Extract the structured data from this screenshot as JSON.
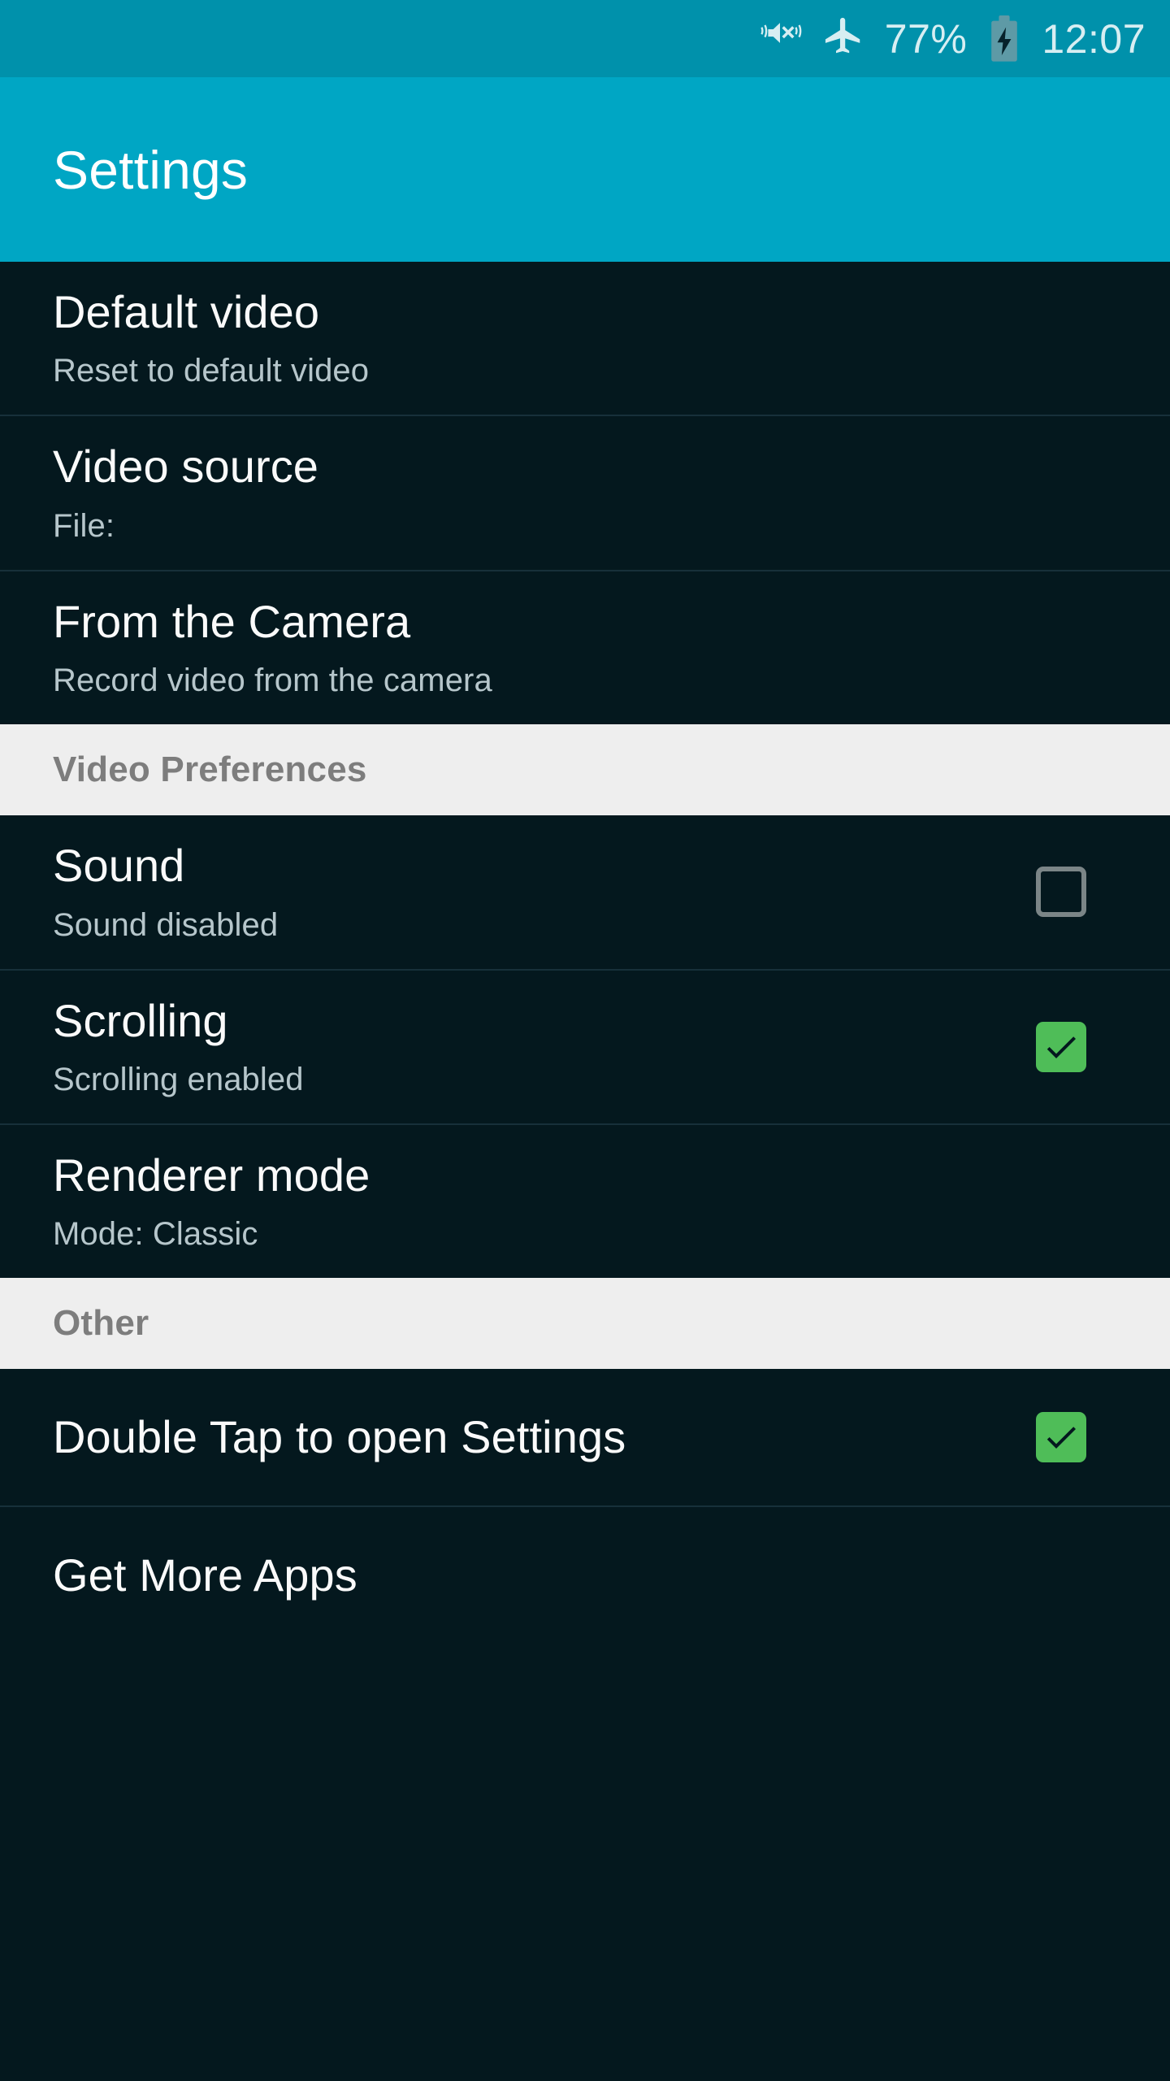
{
  "status_bar": {
    "icons": [
      "vibrate-mute-icon",
      "airplane-mode-icon",
      "battery-charging-icon"
    ],
    "battery_percent": "77%",
    "time": "12:07"
  },
  "app_bar": {
    "title": "Settings"
  },
  "colors": {
    "status_bar_bg": "#0091ab",
    "app_bar_bg": "#00a6c4",
    "list_bg": "#04181e",
    "section_header_bg": "#eeeeee",
    "section_header_text": "#7d7d7d",
    "title_text": "#fafafa",
    "summary_text": "#b6c6cb",
    "checkbox_checked": "#4fbd58",
    "checkbox_unchecked_border": "#7b8587",
    "divider": "#17303a"
  },
  "sections": [
    {
      "header": null,
      "rows": [
        {
          "title": "Default video",
          "summary": "Reset to default video",
          "checkbox": null
        },
        {
          "title": "Video source",
          "summary": "File:",
          "checkbox": null
        },
        {
          "title": "From the Camera",
          "summary": "Record video from the camera",
          "checkbox": null
        }
      ]
    },
    {
      "header": "Video Preferences",
      "rows": [
        {
          "title": "Sound",
          "summary": "Sound disabled",
          "checkbox": "unchecked"
        },
        {
          "title": "Scrolling",
          "summary": "Scrolling enabled",
          "checkbox": "checked"
        },
        {
          "title": "Renderer mode",
          "summary": "Mode: Classic",
          "checkbox": null
        }
      ]
    },
    {
      "header": "Other",
      "rows": [
        {
          "title": "Double Tap to open Settings",
          "summary": null,
          "checkbox": "checked"
        },
        {
          "title": "Get More Apps",
          "summary": null,
          "checkbox": null
        }
      ]
    }
  ]
}
